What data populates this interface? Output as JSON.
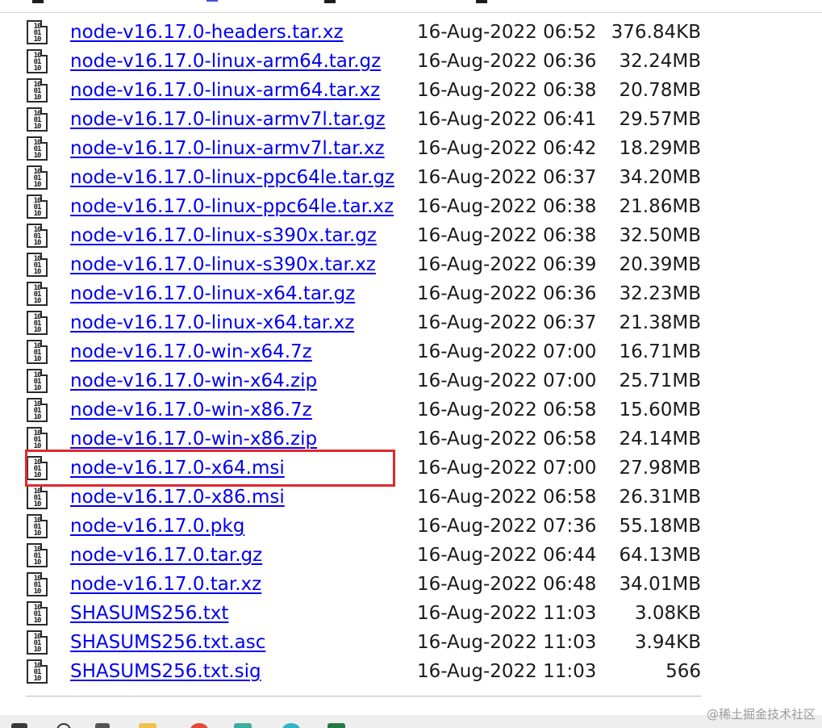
{
  "listing": {
    "rows": [
      {
        "name": "node-v16.17.0-headers.tar.xz",
        "date": "16-Aug-2022 06:52",
        "size": "376.84KB"
      },
      {
        "name": "node-v16.17.0-linux-arm64.tar.gz",
        "date": "16-Aug-2022 06:36",
        "size": "32.24MB"
      },
      {
        "name": "node-v16.17.0-linux-arm64.tar.xz",
        "date": "16-Aug-2022 06:38",
        "size": "20.78MB"
      },
      {
        "name": "node-v16.17.0-linux-armv7l.tar.gz",
        "date": "16-Aug-2022 06:41",
        "size": "29.57MB"
      },
      {
        "name": "node-v16.17.0-linux-armv7l.tar.xz",
        "date": "16-Aug-2022 06:42",
        "size": "18.29MB"
      },
      {
        "name": "node-v16.17.0-linux-ppc64le.tar.gz",
        "date": "16-Aug-2022 06:37",
        "size": "34.20MB"
      },
      {
        "name": "node-v16.17.0-linux-ppc64le.tar.xz",
        "date": "16-Aug-2022 06:38",
        "size": "21.86MB"
      },
      {
        "name": "node-v16.17.0-linux-s390x.tar.gz",
        "date": "16-Aug-2022 06:38",
        "size": "32.50MB"
      },
      {
        "name": "node-v16.17.0-linux-s390x.tar.xz",
        "date": "16-Aug-2022 06:39",
        "size": "20.39MB"
      },
      {
        "name": "node-v16.17.0-linux-x64.tar.gz",
        "date": "16-Aug-2022 06:36",
        "size": "32.23MB"
      },
      {
        "name": "node-v16.17.0-linux-x64.tar.xz",
        "date": "16-Aug-2022 06:37",
        "size": "21.38MB"
      },
      {
        "name": "node-v16.17.0-win-x64.7z",
        "date": "16-Aug-2022 07:00",
        "size": "16.71MB"
      },
      {
        "name": "node-v16.17.0-win-x64.zip",
        "date": "16-Aug-2022 07:00",
        "size": "25.71MB"
      },
      {
        "name": "node-v16.17.0-win-x86.7z",
        "date": "16-Aug-2022 06:58",
        "size": "15.60MB"
      },
      {
        "name": "node-v16.17.0-win-x86.zip",
        "date": "16-Aug-2022 06:58",
        "size": "24.14MB"
      },
      {
        "name": "node-v16.17.0-x64.msi",
        "date": "16-Aug-2022 07:00",
        "size": "27.98MB",
        "highlighted": true
      },
      {
        "name": "node-v16.17.0-x86.msi",
        "date": "16-Aug-2022 06:58",
        "size": "26.31MB"
      },
      {
        "name": "node-v16.17.0.pkg",
        "date": "16-Aug-2022 07:36",
        "size": "55.18MB"
      },
      {
        "name": "node-v16.17.0.tar.gz",
        "date": "16-Aug-2022 06:44",
        "size": "64.13MB"
      },
      {
        "name": "node-v16.17.0.tar.xz",
        "date": "16-Aug-2022 06:48",
        "size": "34.01MB"
      },
      {
        "name": "SHASUMS256.txt",
        "date": "16-Aug-2022 11:03",
        "size": "3.08KB"
      },
      {
        "name": "SHASUMS256.txt.asc",
        "date": "16-Aug-2022 11:03",
        "size": "3.94KB"
      },
      {
        "name": "SHASUMS256.txt.sig",
        "date": "16-Aug-2022 11:03",
        "size": "566"
      }
    ]
  },
  "file_icon": {
    "icon": "binary-file-icon",
    "glyph": "10\n01\n10"
  },
  "highlight": {
    "color": "#e0282c",
    "target": "node-v16.17.0-x64.msi"
  },
  "colors": {
    "link": "#0000ee",
    "text": "#1a1a1a"
  },
  "watermark": {
    "text": "@稀土掘金技术社区"
  },
  "taskbar": {
    "icons": [
      "windows-start-icon",
      "search-icon",
      "task-view-icon",
      "file-explorer-icon",
      "chrome-icon",
      "app-icon",
      "edge-icon",
      "excel-icon"
    ]
  }
}
